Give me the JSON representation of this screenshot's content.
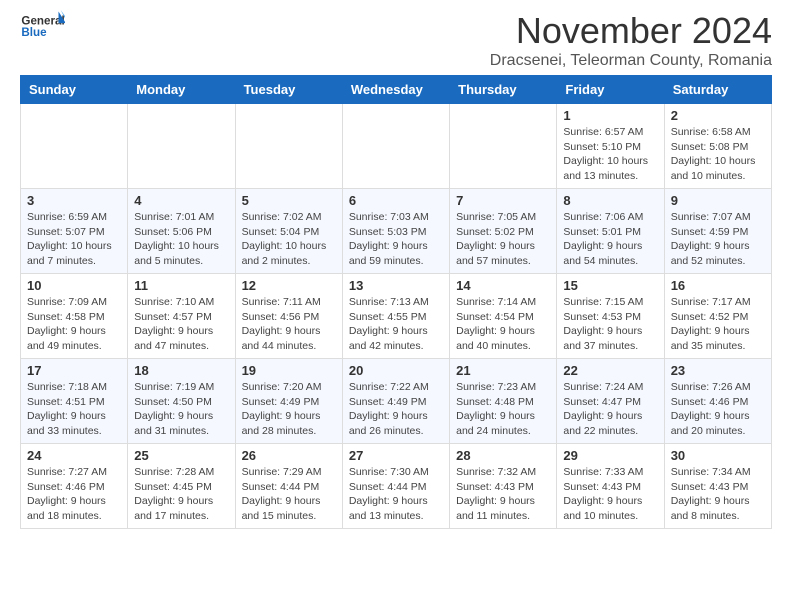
{
  "header": {
    "logo_general": "General",
    "logo_blue": "Blue",
    "month_title": "November 2024",
    "location": "Dracsenei, Teleorman County, Romania"
  },
  "calendar": {
    "days_of_week": [
      "Sunday",
      "Monday",
      "Tuesday",
      "Wednesday",
      "Thursday",
      "Friday",
      "Saturday"
    ],
    "weeks": [
      [
        {
          "day": "",
          "info": ""
        },
        {
          "day": "",
          "info": ""
        },
        {
          "day": "",
          "info": ""
        },
        {
          "day": "",
          "info": ""
        },
        {
          "day": "",
          "info": ""
        },
        {
          "day": "1",
          "info": "Sunrise: 6:57 AM\nSunset: 5:10 PM\nDaylight: 10 hours and 13 minutes."
        },
        {
          "day": "2",
          "info": "Sunrise: 6:58 AM\nSunset: 5:08 PM\nDaylight: 10 hours and 10 minutes."
        }
      ],
      [
        {
          "day": "3",
          "info": "Sunrise: 6:59 AM\nSunset: 5:07 PM\nDaylight: 10 hours and 7 minutes."
        },
        {
          "day": "4",
          "info": "Sunrise: 7:01 AM\nSunset: 5:06 PM\nDaylight: 10 hours and 5 minutes."
        },
        {
          "day": "5",
          "info": "Sunrise: 7:02 AM\nSunset: 5:04 PM\nDaylight: 10 hours and 2 minutes."
        },
        {
          "day": "6",
          "info": "Sunrise: 7:03 AM\nSunset: 5:03 PM\nDaylight: 9 hours and 59 minutes."
        },
        {
          "day": "7",
          "info": "Sunrise: 7:05 AM\nSunset: 5:02 PM\nDaylight: 9 hours and 57 minutes."
        },
        {
          "day": "8",
          "info": "Sunrise: 7:06 AM\nSunset: 5:01 PM\nDaylight: 9 hours and 54 minutes."
        },
        {
          "day": "9",
          "info": "Sunrise: 7:07 AM\nSunset: 4:59 PM\nDaylight: 9 hours and 52 minutes."
        }
      ],
      [
        {
          "day": "10",
          "info": "Sunrise: 7:09 AM\nSunset: 4:58 PM\nDaylight: 9 hours and 49 minutes."
        },
        {
          "day": "11",
          "info": "Sunrise: 7:10 AM\nSunset: 4:57 PM\nDaylight: 9 hours and 47 minutes."
        },
        {
          "day": "12",
          "info": "Sunrise: 7:11 AM\nSunset: 4:56 PM\nDaylight: 9 hours and 44 minutes."
        },
        {
          "day": "13",
          "info": "Sunrise: 7:13 AM\nSunset: 4:55 PM\nDaylight: 9 hours and 42 minutes."
        },
        {
          "day": "14",
          "info": "Sunrise: 7:14 AM\nSunset: 4:54 PM\nDaylight: 9 hours and 40 minutes."
        },
        {
          "day": "15",
          "info": "Sunrise: 7:15 AM\nSunset: 4:53 PM\nDaylight: 9 hours and 37 minutes."
        },
        {
          "day": "16",
          "info": "Sunrise: 7:17 AM\nSunset: 4:52 PM\nDaylight: 9 hours and 35 minutes."
        }
      ],
      [
        {
          "day": "17",
          "info": "Sunrise: 7:18 AM\nSunset: 4:51 PM\nDaylight: 9 hours and 33 minutes."
        },
        {
          "day": "18",
          "info": "Sunrise: 7:19 AM\nSunset: 4:50 PM\nDaylight: 9 hours and 31 minutes."
        },
        {
          "day": "19",
          "info": "Sunrise: 7:20 AM\nSunset: 4:49 PM\nDaylight: 9 hours and 28 minutes."
        },
        {
          "day": "20",
          "info": "Sunrise: 7:22 AM\nSunset: 4:49 PM\nDaylight: 9 hours and 26 minutes."
        },
        {
          "day": "21",
          "info": "Sunrise: 7:23 AM\nSunset: 4:48 PM\nDaylight: 9 hours and 24 minutes."
        },
        {
          "day": "22",
          "info": "Sunrise: 7:24 AM\nSunset: 4:47 PM\nDaylight: 9 hours and 22 minutes."
        },
        {
          "day": "23",
          "info": "Sunrise: 7:26 AM\nSunset: 4:46 PM\nDaylight: 9 hours and 20 minutes."
        }
      ],
      [
        {
          "day": "24",
          "info": "Sunrise: 7:27 AM\nSunset: 4:46 PM\nDaylight: 9 hours and 18 minutes."
        },
        {
          "day": "25",
          "info": "Sunrise: 7:28 AM\nSunset: 4:45 PM\nDaylight: 9 hours and 17 minutes."
        },
        {
          "day": "26",
          "info": "Sunrise: 7:29 AM\nSunset: 4:44 PM\nDaylight: 9 hours and 15 minutes."
        },
        {
          "day": "27",
          "info": "Sunrise: 7:30 AM\nSunset: 4:44 PM\nDaylight: 9 hours and 13 minutes."
        },
        {
          "day": "28",
          "info": "Sunrise: 7:32 AM\nSunset: 4:43 PM\nDaylight: 9 hours and 11 minutes."
        },
        {
          "day": "29",
          "info": "Sunrise: 7:33 AM\nSunset: 4:43 PM\nDaylight: 9 hours and 10 minutes."
        },
        {
          "day": "30",
          "info": "Sunrise: 7:34 AM\nSunset: 4:43 PM\nDaylight: 9 hours and 8 minutes."
        }
      ]
    ]
  }
}
